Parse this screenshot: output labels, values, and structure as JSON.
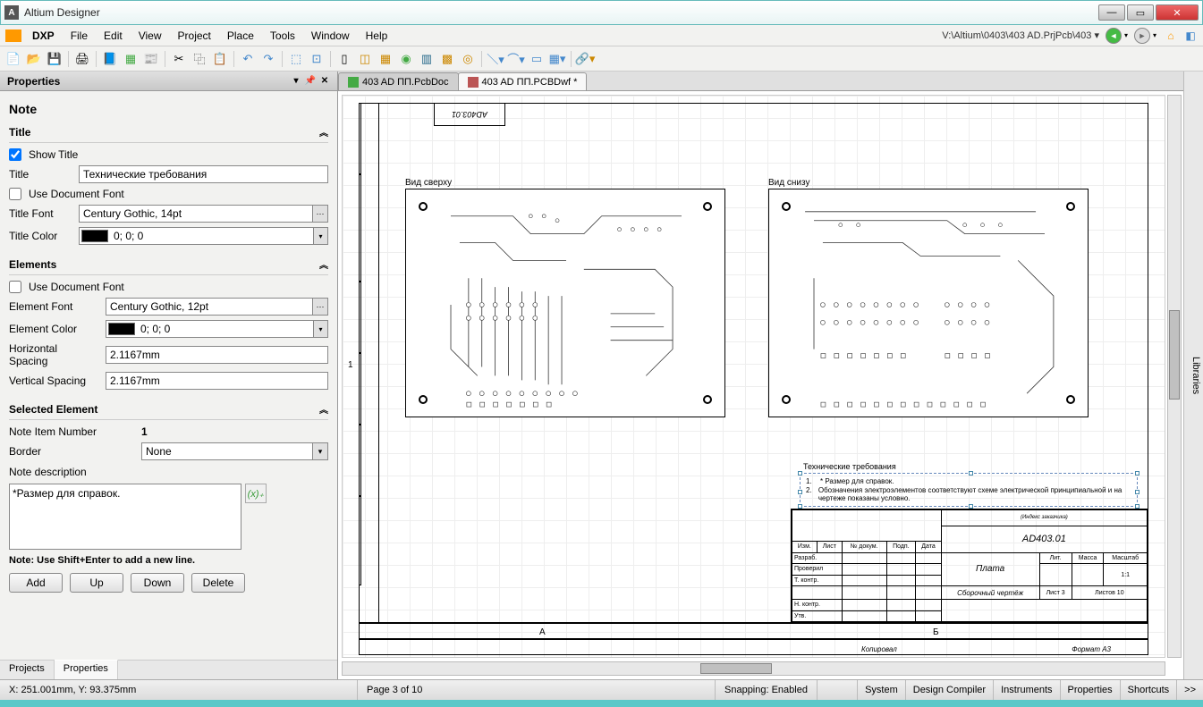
{
  "window": {
    "title": "Altium Designer",
    "min": "—",
    "max": "▭",
    "close": "✕"
  },
  "menu": {
    "dxp": "DXP",
    "items": [
      "File",
      "Edit",
      "View",
      "Project",
      "Place",
      "Tools",
      "Window",
      "Help"
    ],
    "project_path": "V:\\Altium\\0403\\403 AD.PrjPcb\\403 ▾"
  },
  "panel": {
    "title": "Properties",
    "section": "Note",
    "title_section": {
      "header": "Title",
      "show_title_label": "Show Title",
      "show_title_checked": true,
      "title_label": "Title",
      "title_value": "Технические требования",
      "use_doc_font_label": "Use Document Font",
      "use_doc_font_checked": false,
      "font_label": "Title Font",
      "font_value": "Century Gothic, 14pt",
      "color_label": "Title Color",
      "color_value": "0; 0; 0"
    },
    "elements_section": {
      "header": "Elements",
      "use_doc_font_label": "Use Document Font",
      "use_doc_font_checked": false,
      "font_label": "Element Font",
      "font_value": "Century Gothic, 12pt",
      "color_label": "Element Color",
      "color_value": "0; 0; 0",
      "hspace_label": "Horizontal Spacing",
      "hspace_value": "2.1167mm",
      "vspace_label": "Vertical Spacing",
      "vspace_value": "2.1167mm"
    },
    "selected_section": {
      "header": "Selected Element",
      "item_num_label": "Note Item Number",
      "item_num_value": "1",
      "border_label": "Border",
      "border_value": "None",
      "desc_label": "Note description",
      "desc_value": "*Размер для справок.",
      "hint": "Note: Use Shift+Enter to add a new line.",
      "buttons": [
        "Add",
        "Up",
        "Down",
        "Delete"
      ]
    },
    "tabs": [
      "Projects",
      "Properties"
    ],
    "active_tab": 1
  },
  "doc_tabs": [
    {
      "label": "403 AD ПП.PcbDoc",
      "active": false
    },
    {
      "label": "403 AD ПП.PCBDwf *",
      "active": true
    }
  ],
  "drawing": {
    "top_box": "AD403.01",
    "view_top": "Вид сверху",
    "view_bottom": "Вид снизу",
    "coord_a": "А",
    "coord_b": "Б",
    "coord_1": "1",
    "note_title": "Технические требования",
    "notes": [
      {
        "n": "1.",
        "t": "* Размер для справок."
      },
      {
        "n": "2.",
        "t": "Обозначения электроэлементов соответствуют схеме электрической принципиальной и на чертеже показаны условно."
      }
    ],
    "tb": {
      "index": "(Индекс заказчика)",
      "code": "AD403.01",
      "name": "Плата",
      "sub": "Сборочный чертёж",
      "lit": "Лит.",
      "mass": "Масса",
      "scale": "Масштаб",
      "scale_v": "1:1",
      "sheet": "Лист",
      "sheet_v": "3",
      "sheets": "Листов",
      "sheets_v": "10",
      "format": "Формат А3",
      "cols": [
        "Изм.",
        "Лист",
        "№ докум.",
        "Подп.",
        "Дата"
      ],
      "rows": [
        "Разраб.",
        "Проверил",
        "Т. контр.",
        "",
        "Н. контр.",
        "Утв."
      ],
      "copied": "Копировал"
    }
  },
  "right_panel": "Libraries",
  "status": {
    "coords": "X: 251.001mm, Y: 93.375mm",
    "page": "Page 3 of 10",
    "snap": "Snapping: Enabled",
    "tabs": [
      "System",
      "Design Compiler",
      "Instruments",
      "Properties",
      "Shortcuts"
    ],
    "more": ">>"
  }
}
